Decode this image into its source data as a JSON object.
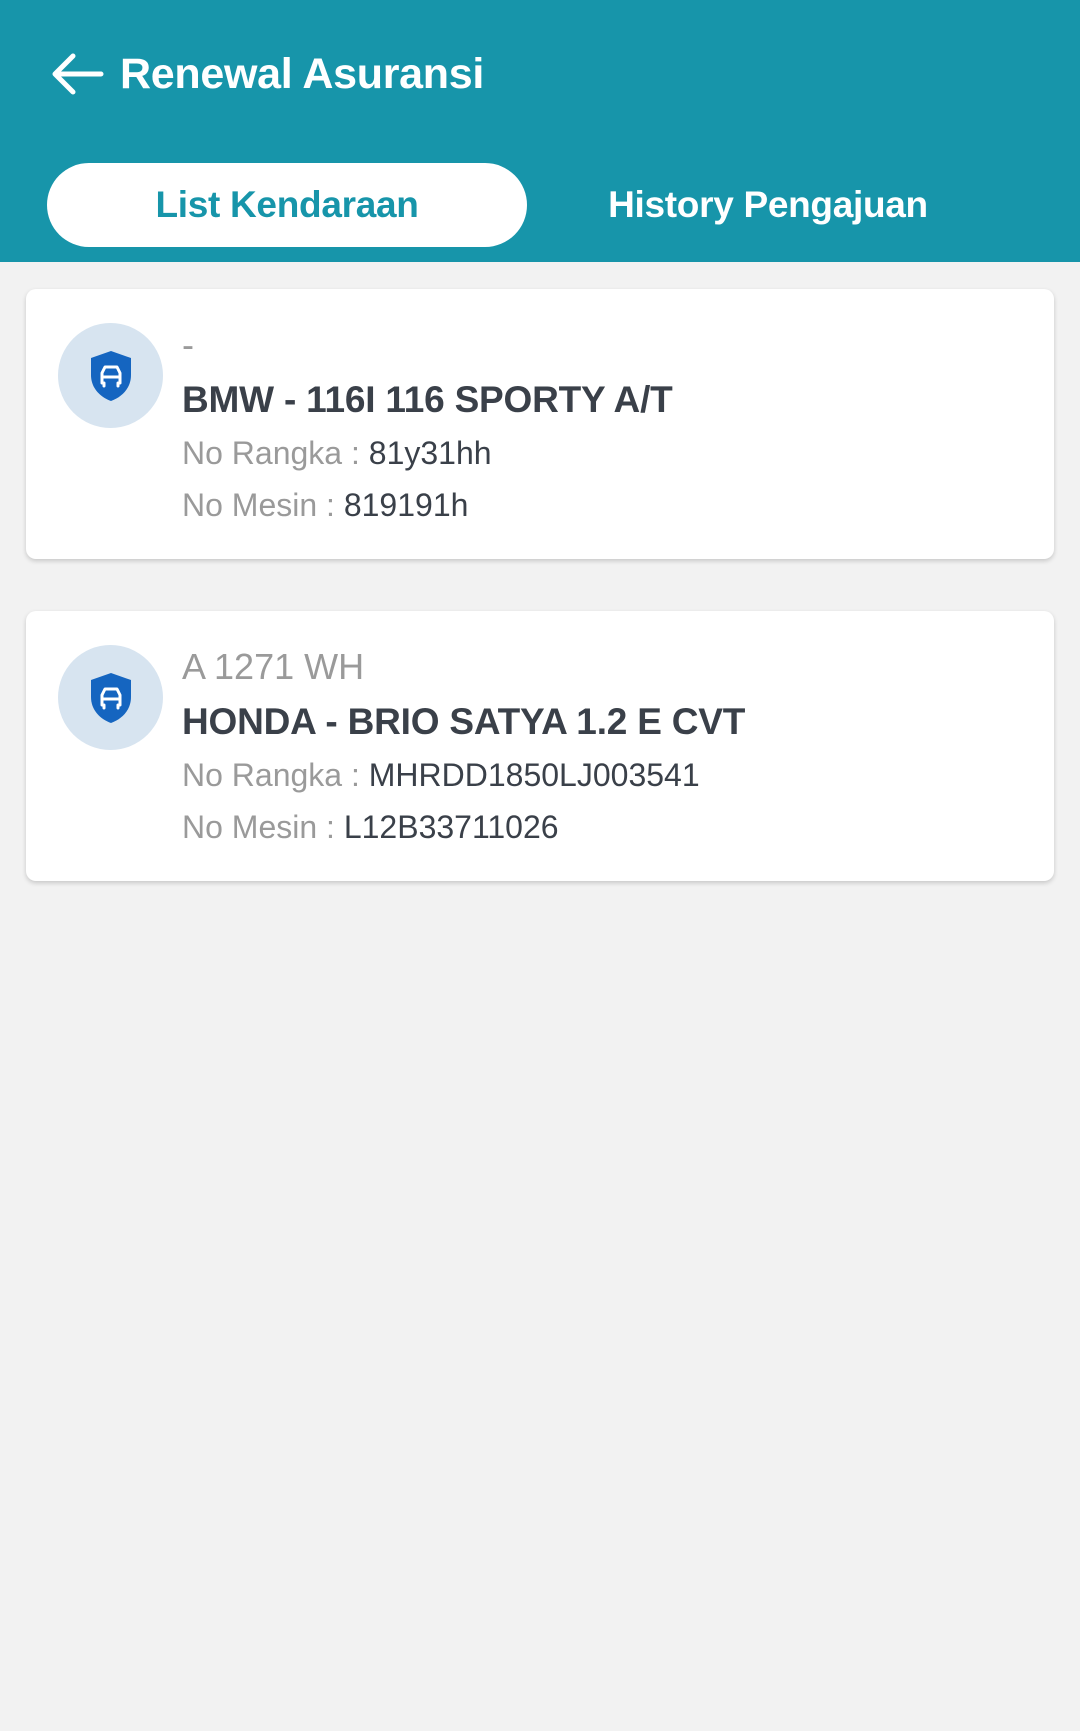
{
  "header": {
    "title": "Renewal Asuransi",
    "back_icon": "arrow-left-icon"
  },
  "tabs": [
    {
      "label": "List Kendaraan",
      "active": true
    },
    {
      "label": "History Pengajuan",
      "active": false
    }
  ],
  "vehicles": [
    {
      "icon": "car-shield-icon",
      "plate": "-",
      "model": "BMW - 116I 116 SPORTY A/T",
      "rangka_label": "No Rangka : ",
      "rangka_value": "81y31hh",
      "mesin_label": "No Mesin : ",
      "mesin_value": "819191h"
    },
    {
      "icon": "car-shield-icon",
      "plate": "A 1271 WH",
      "model": "HONDA - BRIO SATYA 1.2 E CVT",
      "rangka_label": "No Rangka : ",
      "rangka_value": "MHRDD1850LJ003541",
      "mesin_label": "No Mesin : ",
      "mesin_value": "L12B33711026"
    }
  ],
  "colors": {
    "primary": "#1795aa",
    "background": "#f2f2f2",
    "icon_bg": "#d7e4f0",
    "icon_fg": "#1565c0",
    "text_dark": "#3a4049",
    "text_muted": "#9a9a9a"
  }
}
